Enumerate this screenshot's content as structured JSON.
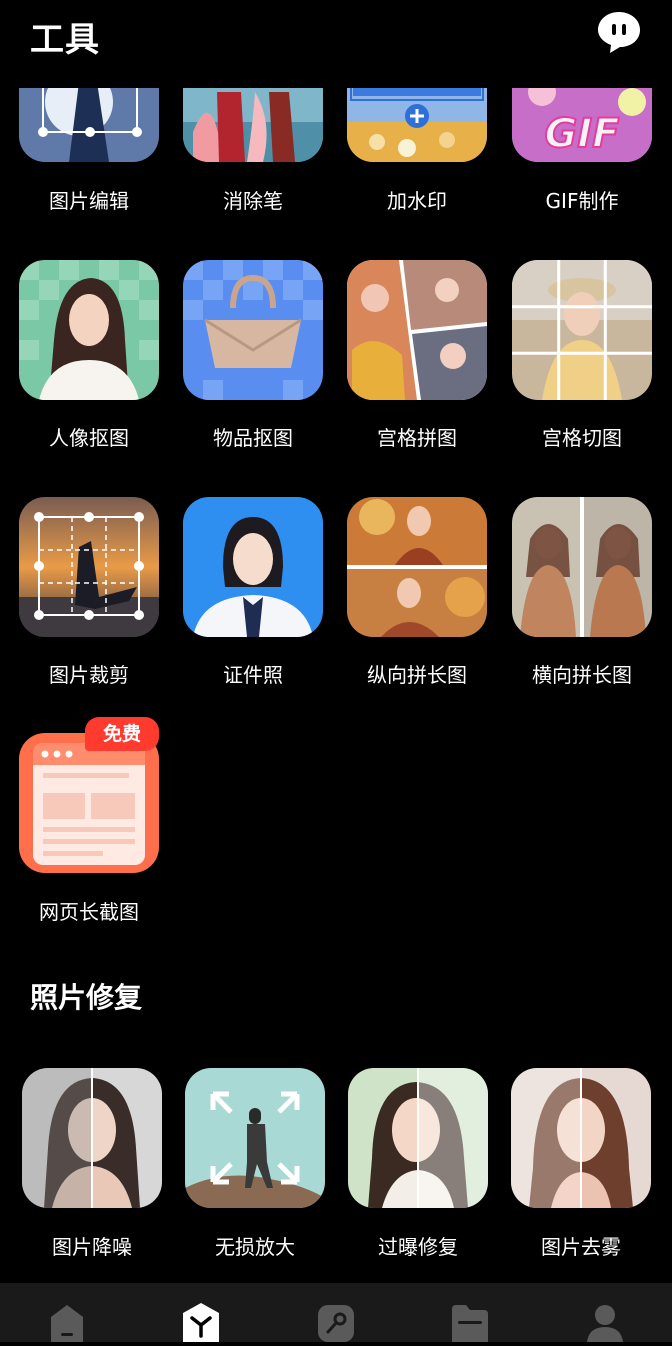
{
  "header": {
    "title": "工具"
  },
  "tools": {
    "row0": [
      "图片编辑",
      "消除笔",
      "加水印",
      "GIF制作"
    ],
    "row1": [
      "人像抠图",
      "物品抠图",
      "宫格拼图",
      "宫格切图"
    ],
    "row2": [
      "图片裁剪",
      "证件照",
      "纵向拼长图",
      "横向拼长图"
    ],
    "row3": [
      "网页长截图"
    ],
    "gif_text": "GIF",
    "free_badge": "免费"
  },
  "repair": {
    "title": "照片修复",
    "items": [
      "图片降噪",
      "无损放大",
      "过曝修复",
      "图片去雾"
    ]
  },
  "colors": {
    "background": "#000000",
    "badge": "#ff3b30",
    "nav": "#1a1a1a"
  }
}
